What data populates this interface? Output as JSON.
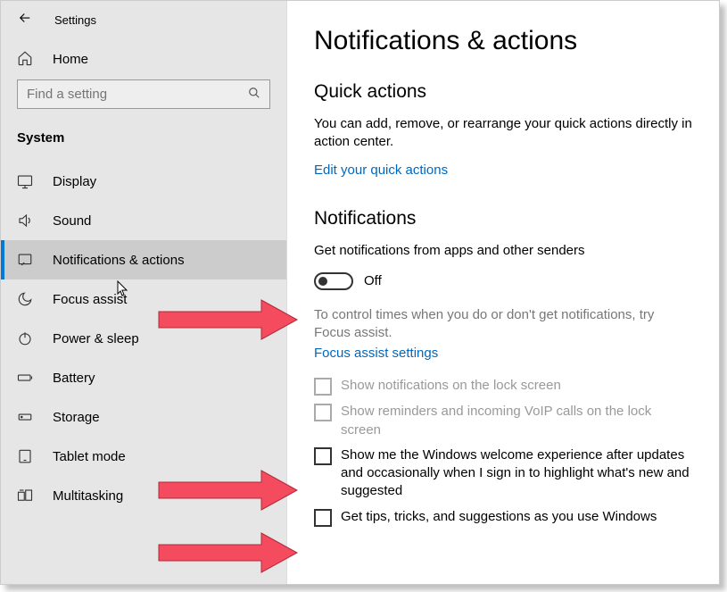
{
  "window": {
    "title": "Settings"
  },
  "sidebar": {
    "home_label": "Home",
    "search_placeholder": "Find a setting",
    "category": "System",
    "items": [
      {
        "label": "Display",
        "icon": "display"
      },
      {
        "label": "Sound",
        "icon": "sound"
      },
      {
        "label": "Notifications & actions",
        "icon": "notifications",
        "active": true
      },
      {
        "label": "Focus assist",
        "icon": "moon"
      },
      {
        "label": "Power & sleep",
        "icon": "power"
      },
      {
        "label": "Battery",
        "icon": "battery"
      },
      {
        "label": "Storage",
        "icon": "storage"
      },
      {
        "label": "Tablet mode",
        "icon": "tablet"
      },
      {
        "label": "Multitasking",
        "icon": "multitasking"
      }
    ]
  },
  "content": {
    "title": "Notifications & actions",
    "quick_actions": {
      "heading": "Quick actions",
      "desc": "You can add, remove, or rearrange your quick actions directly in action center.",
      "link": "Edit your quick actions"
    },
    "notifications": {
      "heading": "Notifications",
      "toggle_desc": "Get notifications from apps and other senders",
      "toggle_state": "Off",
      "focus_desc": "To control times when you do or don't get notifications, try Focus assist.",
      "focus_link": "Focus assist settings",
      "checkboxes": [
        {
          "label": "Show notifications on the lock screen",
          "disabled": true
        },
        {
          "label": "Show reminders and incoming VoIP calls on the lock screen",
          "disabled": true
        },
        {
          "label": "Show me the Windows welcome experience after updates and occasionally when I sign in to highlight what's new and suggested",
          "disabled": false
        },
        {
          "label": "Get tips, tricks, and suggestions as you use Windows",
          "disabled": false
        }
      ]
    }
  },
  "annotations": {
    "arrow_color": "#f44c5e"
  }
}
